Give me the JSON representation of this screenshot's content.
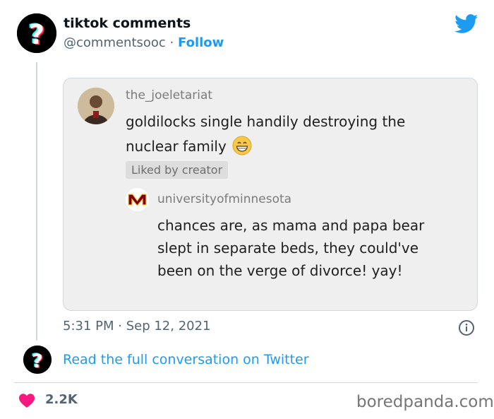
{
  "tweet": {
    "author_name": "tiktok comments",
    "author_handle": "@commentsooc",
    "separator": "·",
    "follow_label": "Follow",
    "timestamp": "5:31 PM · Sep 12, 2021",
    "read_more_label": "Read the full conversation on Twitter",
    "likes_count": "2.2K"
  },
  "embedded_screenshot": {
    "comment": {
      "username": "the_joeletariat",
      "text": "goldilocks single handily destroying the nuclear family",
      "emoji": "grinning-face-emoji",
      "liked_badge": "Liked by creator"
    },
    "reply": {
      "username": "universityofminnesota",
      "text": "chances are, as mama and papa bear slept in separate beds, they could've been on the verge of divorce! yay!"
    }
  },
  "watermark": "boredpanda.com",
  "icons": {
    "avatar": "tiktok-question-mark-logo",
    "brand": "twitter-bird-icon",
    "info": "info-icon",
    "like": "heart-icon"
  },
  "colors": {
    "link": "#1d9bf0",
    "muted": "#536471",
    "heart": "#f91880",
    "card_bg": "#efefef"
  }
}
